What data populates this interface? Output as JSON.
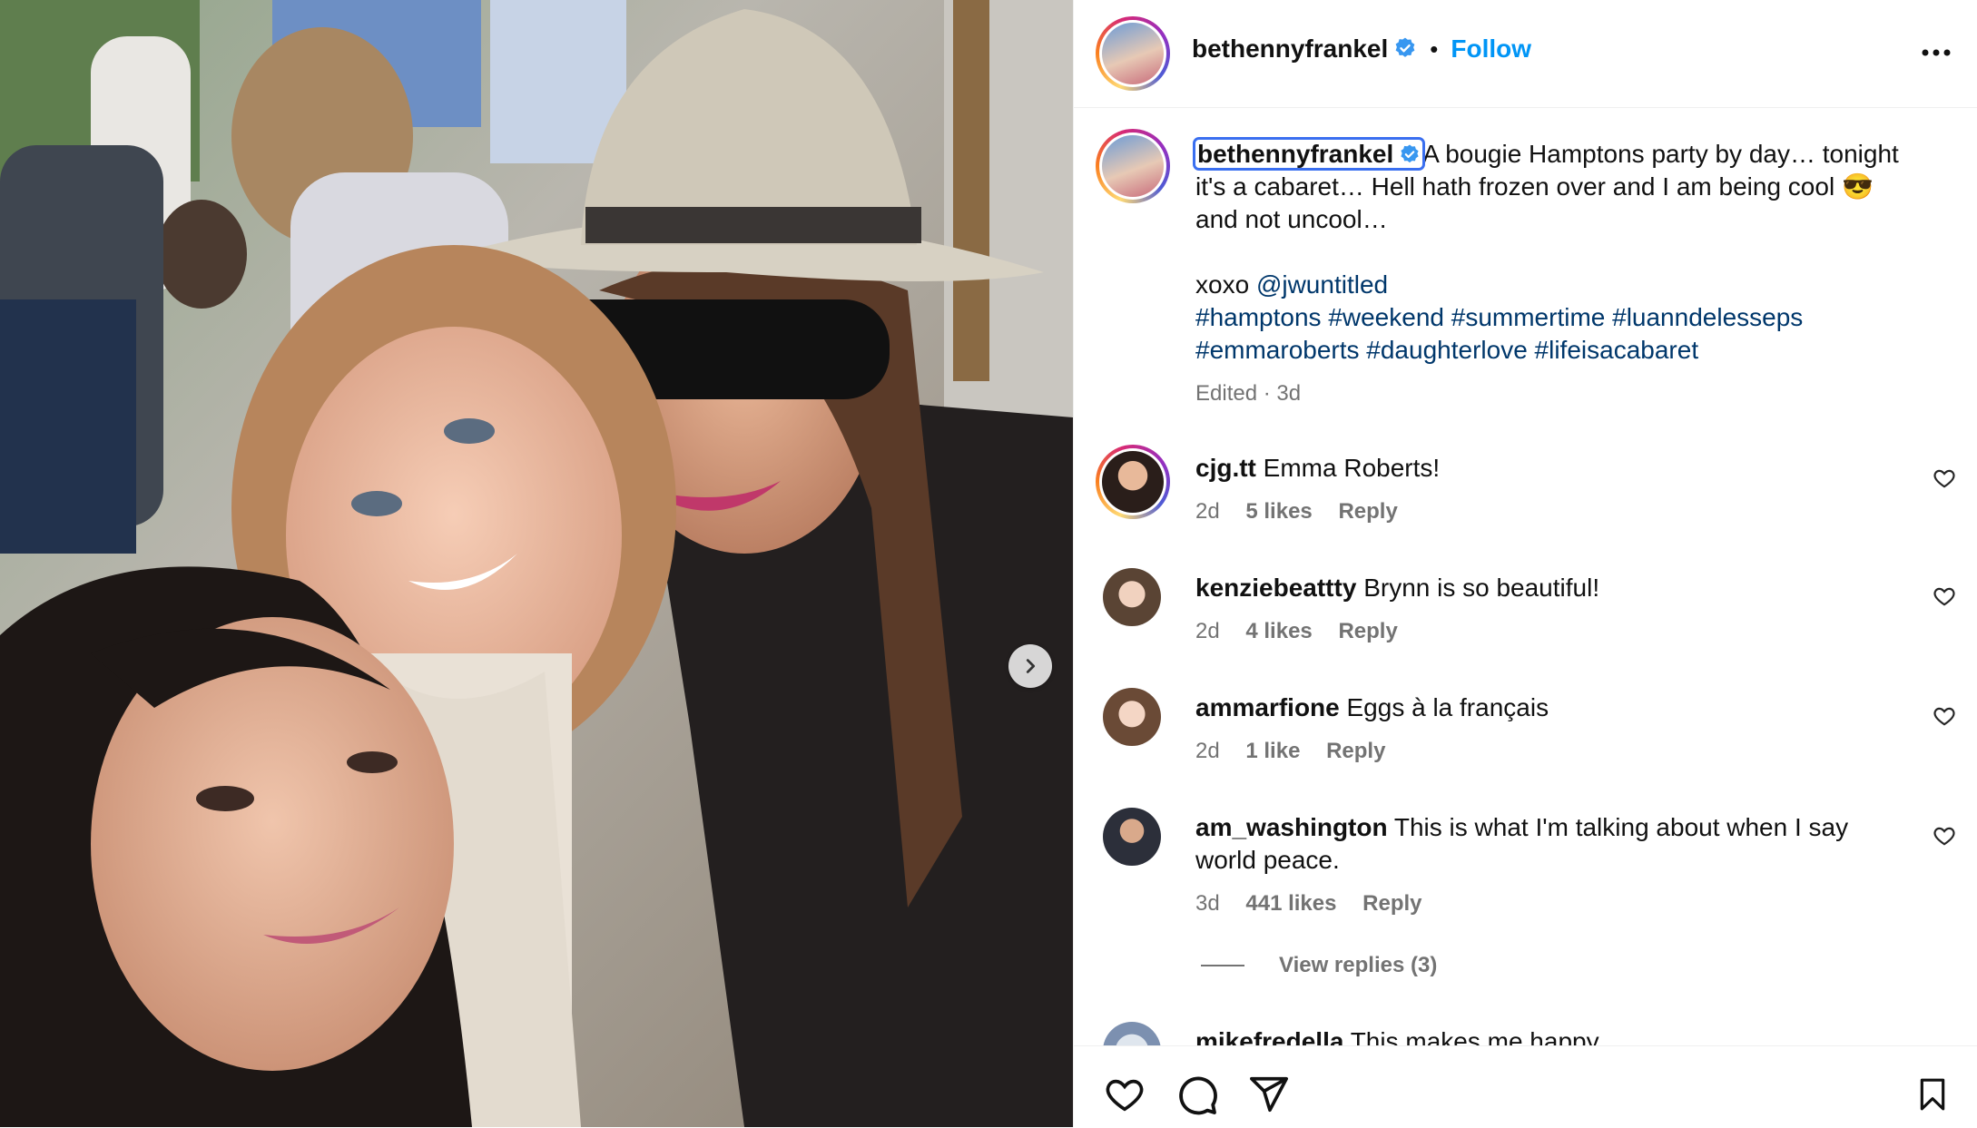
{
  "post": {
    "username": "bethennyfrankel",
    "follow_label": "Follow",
    "separator": "•",
    "more_icon": "more-horizontal-icon"
  },
  "caption": {
    "username": "bethennyfrankel",
    "line1": "A bougie Hamptons party by day… tonight it's a cabaret… Hell hath frozen over and I am being cool 😎 and not uncool…",
    "xoxo": "xoxo ",
    "mention": "@jwuntitled",
    "hashtags_line1": "#hamptons #weekend #summertime #luanndelesseps",
    "hashtags_line2": "#emmaroberts #daughterlove #lifeisacabaret",
    "meta": "Edited · 3d"
  },
  "comments": [
    {
      "user": "cjg.tt",
      "text": "Emma Roberts!",
      "age": "2d",
      "likes": "5 likes",
      "reply": "Reply"
    },
    {
      "user": "kenziebeattty",
      "text": "Brynn is so beautiful!",
      "age": "2d",
      "likes": "4 likes",
      "reply": "Reply"
    },
    {
      "user": "ammarfione",
      "text": "Eggs à la français",
      "age": "2d",
      "likes": "1 like",
      "reply": "Reply"
    },
    {
      "user": "am_washington",
      "text": "This is what I'm talking about when I say world peace.",
      "age": "3d",
      "likes": "441 likes",
      "reply": "Reply"
    },
    {
      "user": "mikefredella",
      "text": "This makes me happy"
    }
  ],
  "view_replies": "View replies (3)",
  "colors": {
    "accent": "#0095f6",
    "link": "#00376b",
    "muted": "#737373",
    "verified": "#3897f0"
  },
  "icons": {
    "like": "heart-icon",
    "comment": "comment-icon",
    "share": "send-icon",
    "save": "bookmark-icon",
    "carousel_next": "chevron-right-icon"
  }
}
